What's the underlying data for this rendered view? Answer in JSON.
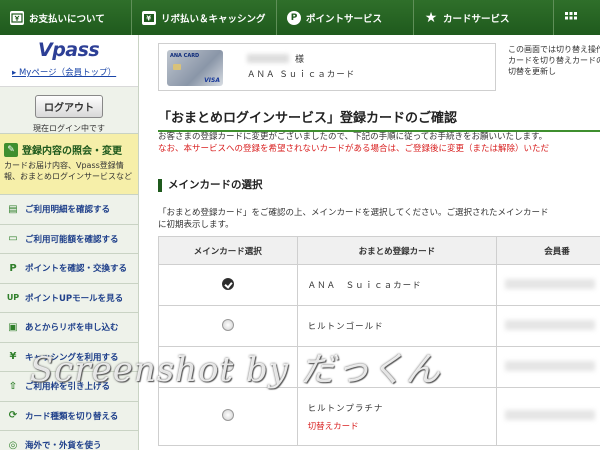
{
  "nav": {
    "items": [
      {
        "label": "お支払いについて",
        "icon": "yen-box-icon"
      },
      {
        "label": "リボ払い＆キャッシング",
        "icon": "revo-icon"
      },
      {
        "label": "ポイントサービス",
        "icon": "point-p-icon"
      },
      {
        "label": "カードサービス",
        "icon": "star-icon"
      }
    ]
  },
  "sidebar": {
    "logo": "Vpass",
    "mypage": "▸ Myページ（会員トップ）",
    "logout": "ログアウト",
    "logged_in": "現在ログイン中です",
    "inquiry_title": "登録内容の照会・変更",
    "inquiry_desc": "カードお届け内容、Vpass登録情報、おまとめログインサービスなど",
    "menu": [
      {
        "label": "ご利用明細を確認する",
        "icon": "statement-icon"
      },
      {
        "label": "ご利用可能額を確認する",
        "icon": "card-icon"
      },
      {
        "label": "ポイントを確認・交換する",
        "icon": "point-icon"
      },
      {
        "label": "ポイントUPモールを見る",
        "icon": "up-mall-icon"
      },
      {
        "label": "あとからリボを申し込む",
        "icon": "revo-apply-icon"
      },
      {
        "label": "キャッシングを利用する",
        "icon": "cash-icon"
      },
      {
        "label": "ご利用枠を引き上げる",
        "icon": "limit-icon"
      },
      {
        "label": "カード種類を切り替える",
        "icon": "switch-icon"
      },
      {
        "label": "海外で・外貨を使う",
        "icon": "overseas-icon"
      }
    ]
  },
  "card_header": {
    "holder_suffix": "様",
    "card_name": "ＡＮＡ Ｓｕｉｃａカード",
    "hint": "この画面では切り替え操作カードを切り替えカードの切替を更新し"
  },
  "main": {
    "title": "「おまとめログインサービス」登録カードのご確認",
    "intro_line1": "お客さまの登録カードに変更がございましたので、下記の手順に従ってお手続きをお願いいたします。",
    "intro_line2": "なお、本サービスへの登録を希望されないカードがある場合は、ご登録後に変更（または解除）いただ",
    "section_title": "メインカードの選択",
    "section_desc_line1": "「おまとめ登録カード」をご確認の上、メインカードを選択してください。ご選択されたメインカード",
    "section_desc_line2": "に初期表示します。"
  },
  "table": {
    "headers": [
      "メインカード選択",
      "おまとめ登録カード",
      "会員番"
    ],
    "rows": [
      {
        "card": "ＡＮＡ　Ｓｕｉｃａカード",
        "selected": true,
        "link": ""
      },
      {
        "card": "ヒルトンゴールド",
        "selected": false,
        "link": ""
      },
      {
        "card": "",
        "selected": false,
        "link": ""
      },
      {
        "card": "ヒルトンプラチナ",
        "selected": false,
        "link": "切替えカード"
      }
    ]
  },
  "watermark": "Screenshot by だっくん",
  "colors": {
    "nav_green": "#1f5a1d",
    "accent_green": "#3f8f2f",
    "link_blue": "#1a45a8",
    "alert_red": "#d81f1f",
    "inquiry_yellow": "#f6efa9"
  }
}
